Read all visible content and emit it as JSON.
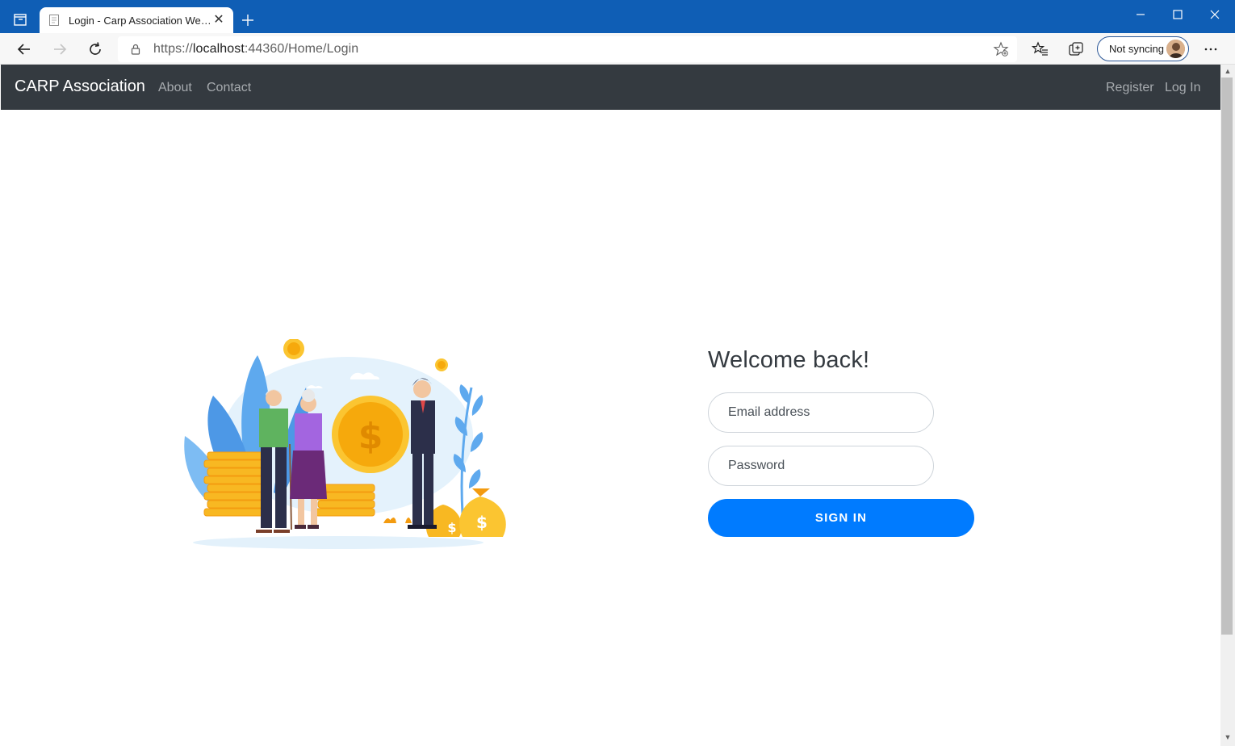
{
  "browser": {
    "tab_title": "Login - Carp Association Website",
    "url_scheme": "https://",
    "url_host": "localhost",
    "url_rest": ":44360/Home/Login",
    "sync_label": "Not syncing",
    "accent_color": "#0f5eb5"
  },
  "navbar": {
    "brand": "CARP Association",
    "links": [
      "About",
      "Contact"
    ],
    "right_links": [
      "Register",
      "Log In"
    ],
    "background": "#343a40"
  },
  "login": {
    "heading": "Welcome back!",
    "email_placeholder": "Email address",
    "password_placeholder": "Password",
    "signin_label": "SIGN IN",
    "button_color": "#007bff"
  }
}
